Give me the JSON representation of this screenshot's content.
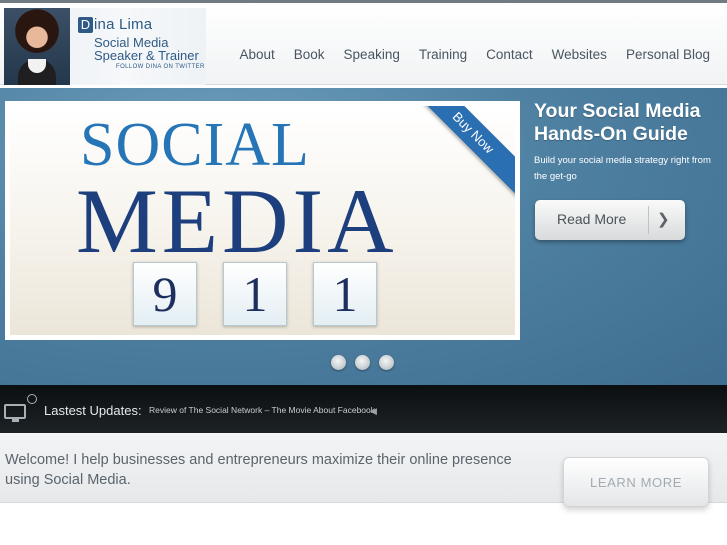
{
  "logo": {
    "name_initial": "D",
    "name_rest": "ina Lima",
    "line1": "Social Media",
    "line2": "Speaker & Trainer",
    "twitter": "FOLLOW DINA ON TWITTER"
  },
  "nav": {
    "items": [
      {
        "label": "About"
      },
      {
        "label": "Book"
      },
      {
        "label": "Speaking"
      },
      {
        "label": "Training"
      },
      {
        "label": "Contact"
      },
      {
        "label": "Websites"
      },
      {
        "label": "Personal Blog"
      }
    ]
  },
  "hero": {
    "image": {
      "word1": "SOCIAL",
      "word2": "MEDIA",
      "digits": [
        "9",
        "1",
        "1"
      ],
      "ribbon": "Buy Now"
    },
    "title": "Your Social Media Hands-On Guide",
    "description": "Build your social media strategy right from the get-go",
    "read_more": "Read More",
    "slides": 3
  },
  "updates": {
    "label": "Lastest Updates:",
    "item": "Review of The Social Network – The Movie About Facebook"
  },
  "welcome": {
    "text": "Welcome! I help businesses and entrepreneurs maximize their online presence using Social Media.",
    "button": "LEARN MORE"
  },
  "colors": {
    "brand_blue": "#2e5b86",
    "hero_bg": "#4f81a2",
    "ribbon": "#2a6fb2"
  }
}
